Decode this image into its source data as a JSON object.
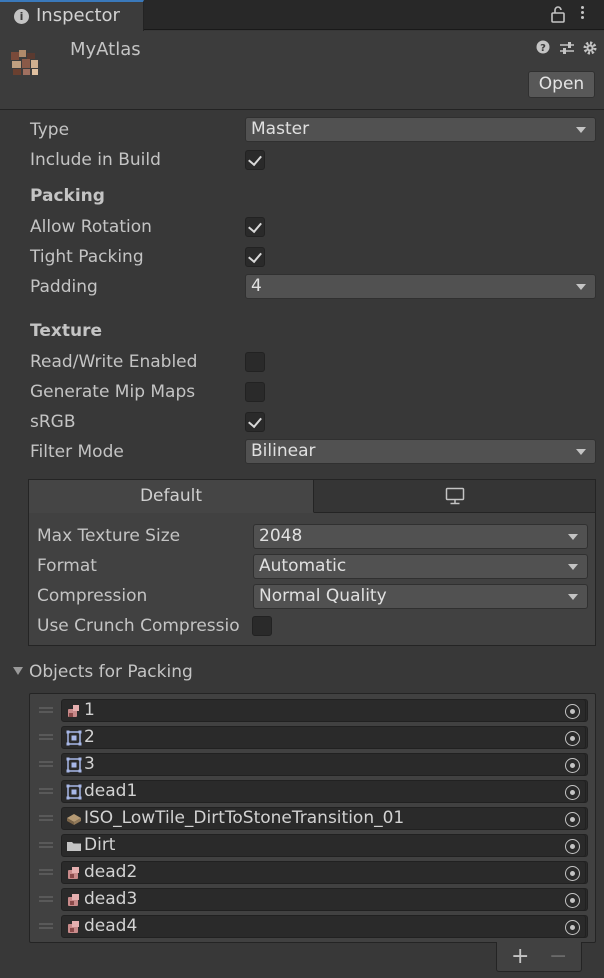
{
  "tab": {
    "title": "Inspector",
    "icons": [
      "info-icon",
      "lock-icon",
      "more-menu-icon"
    ]
  },
  "header": {
    "asset_name": "MyAtlas",
    "open_label": "Open",
    "icons": [
      "help-icon",
      "preset-icon",
      "settings-icon"
    ]
  },
  "general": {
    "type_label": "Type",
    "type_value": "Master",
    "include_label": "Include in Build",
    "include_checked": true
  },
  "packing": {
    "title": "Packing",
    "allow_rotation_label": "Allow Rotation",
    "allow_rotation": true,
    "tight_packing_label": "Tight Packing",
    "tight_packing": true,
    "padding_label": "Padding",
    "padding_value": "4"
  },
  "texture": {
    "title": "Texture",
    "readwrite_label": "Read/Write Enabled",
    "readwrite": false,
    "mipmaps_label": "Generate Mip Maps",
    "mipmaps": false,
    "srgb_label": "sRGB",
    "srgb": true,
    "filter_label": "Filter Mode",
    "filter_value": "Bilinear"
  },
  "platform": {
    "tabs": [
      {
        "label": "Default"
      },
      {
        "label": "",
        "icon": "monitor-icon"
      }
    ],
    "max_size_label": "Max Texture Size",
    "max_size_value": "2048",
    "format_label": "Format",
    "format_value": "Automatic",
    "compression_label": "Compression",
    "compression_value": "Normal Quality",
    "crunch_label": "Use Crunch Compressio",
    "crunch": false
  },
  "objects": {
    "title": "Objects for Packing",
    "items": [
      {
        "name": "1",
        "icon": "sprite-icon"
      },
      {
        "name": "2",
        "icon": "sprite-frame-icon"
      },
      {
        "name": "3",
        "icon": "sprite-frame-icon"
      },
      {
        "name": "dead1",
        "icon": "sprite-frame-icon"
      },
      {
        "name": "ISO_LowTile_DirtToStoneTransition_01",
        "icon": "tile-icon"
      },
      {
        "name": "Dirt",
        "icon": "folder-icon"
      },
      {
        "name": "dead2",
        "icon": "sprite-icon"
      },
      {
        "name": "dead3",
        "icon": "sprite-icon"
      },
      {
        "name": "dead4",
        "icon": "sprite-icon"
      }
    ],
    "add_label": "+",
    "remove_label": "−"
  }
}
